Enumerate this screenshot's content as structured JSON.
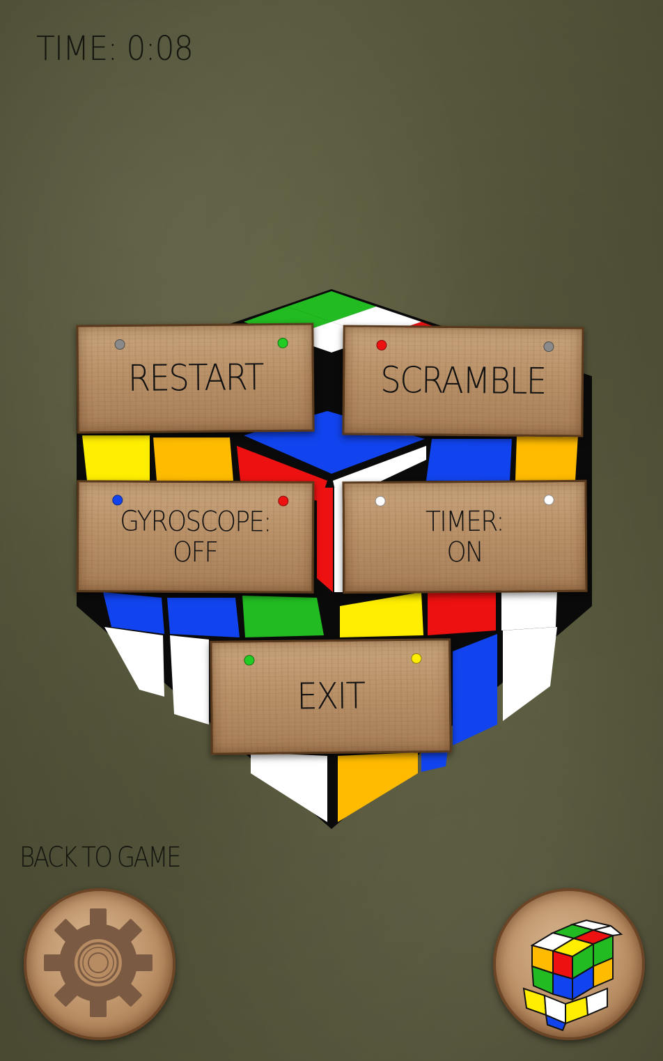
{
  "hud": {
    "timer_text": "TIME: 0:08"
  },
  "menu": {
    "restart_label": "RESTART",
    "scramble_label": "SCRAMBLE",
    "gyroscope_label_line1": "GYROSCOPE:",
    "gyroscope_label_line2": "OFF",
    "timer_label_line1": "TIMER:",
    "timer_label_line2": "ON",
    "exit_label": "EXIT"
  },
  "footer": {
    "back_label": "BACK TO GAME",
    "settings_icon": "gear-icon",
    "cube_icon": "rubiks-cube-icon"
  },
  "colors": {
    "white": "#ffffff",
    "yellow": "#ffee00",
    "orange": "#ffbb00",
    "red": "#ee1111",
    "green": "#22bb22",
    "blue": "#1144ee",
    "wood": "#b89068"
  }
}
